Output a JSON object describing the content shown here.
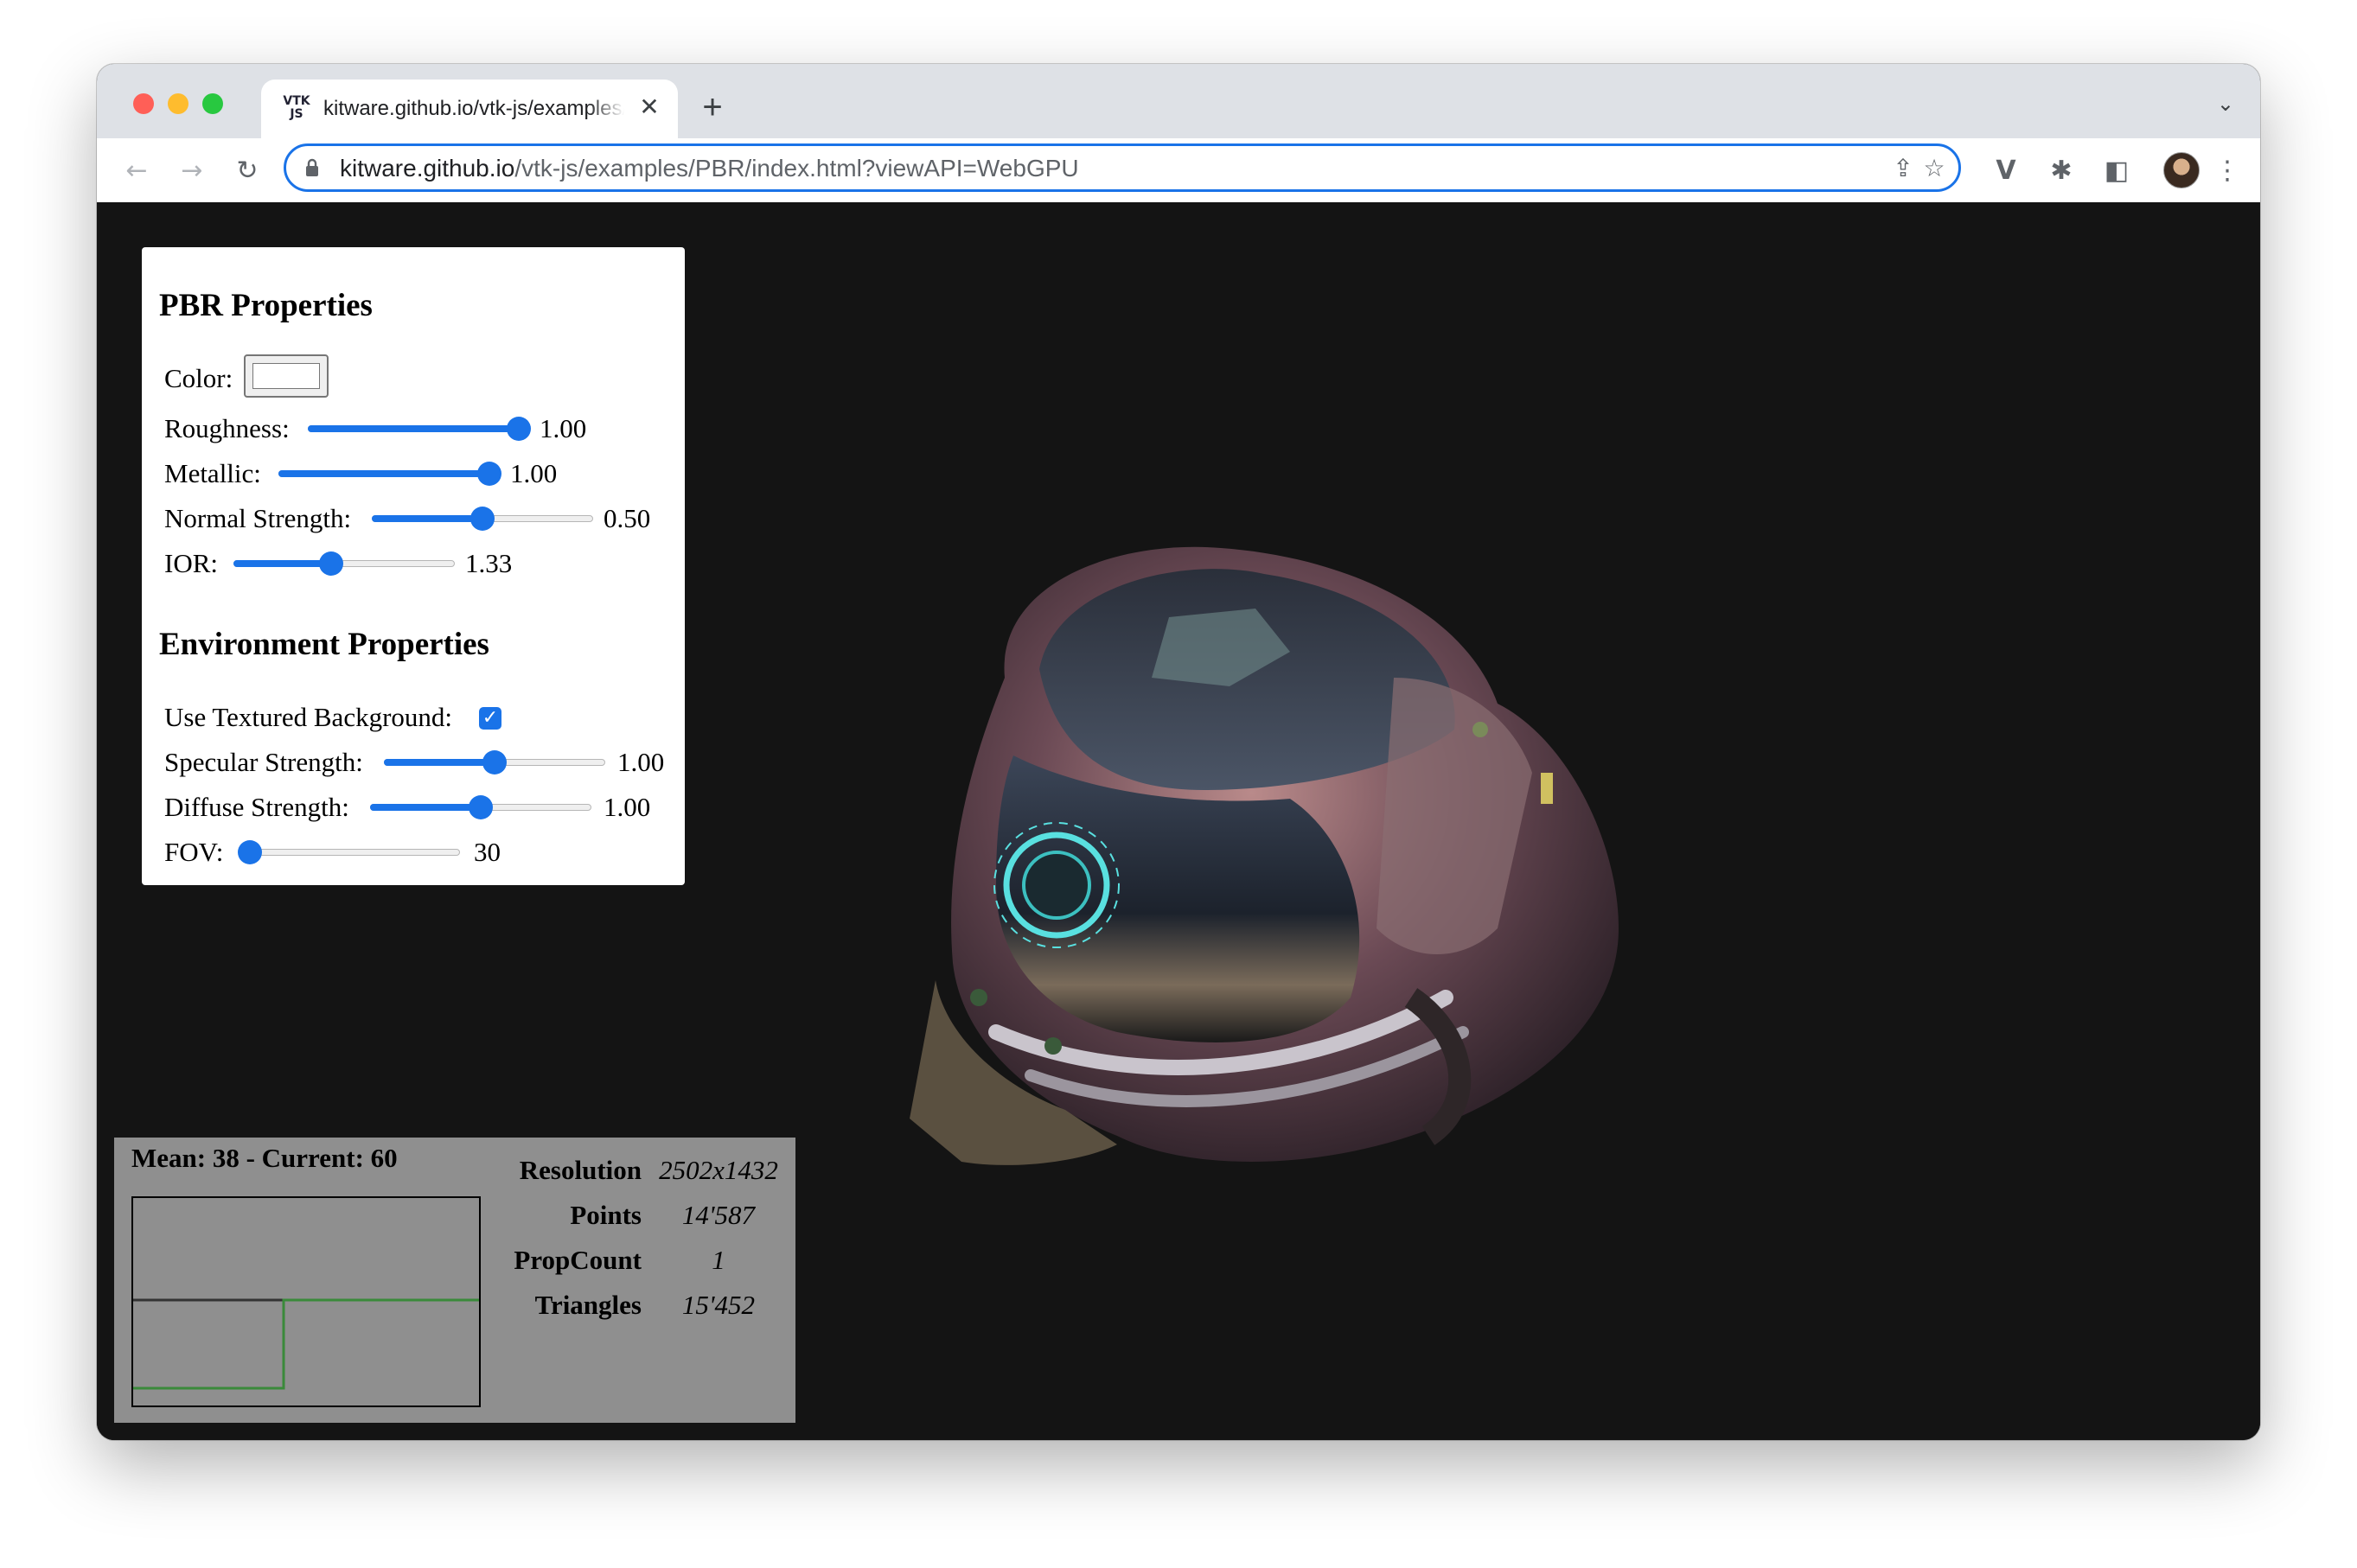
{
  "tab": {
    "title": "kitware.github.io/vtk-js/examples/PBR/index.html?viewAPI=WebGPU",
    "favicon_text": "VTK JS",
    "close_glyph": "✕"
  },
  "toolbar": {
    "url_host": "kitware.github.io",
    "url_path": "/vtk-js/examples/PBR/index.html?viewAPI=WebGPU"
  },
  "icons": {
    "back": "←",
    "forward": "→",
    "reload": "↻",
    "share": "⇪",
    "star": "☆",
    "new_tab": "+",
    "tab_menu": "⌄",
    "vtk": "V",
    "extensions": "✱",
    "sidepanel": "◧",
    "menu": "⋮",
    "check": "✓"
  },
  "colors": {
    "accent": "#1a73e8",
    "viewport_bg": "#141414",
    "stats_bg": "#8f8f8f",
    "graph_line": "#3a8a3a"
  },
  "pbr": {
    "heading": "PBR Properties",
    "color_label": "Color:",
    "color_value": "#ffffff",
    "roughness": {
      "label": "Roughness:",
      "value": "1.00",
      "fraction": 1.0
    },
    "metallic": {
      "label": "Metallic:",
      "value": "1.00",
      "fraction": 1.0
    },
    "normal_strength": {
      "label": "Normal Strength:",
      "value": "0.50",
      "fraction": 0.5
    },
    "ior": {
      "label": "IOR:",
      "value": "1.33",
      "fraction": 0.44
    }
  },
  "env": {
    "heading": "Environment Properties",
    "textured_bg": {
      "label": "Use Textured Background:",
      "checked": true
    },
    "specular_strength": {
      "label": "Specular Strength:",
      "value": "1.00",
      "fraction": 0.5
    },
    "diffuse_strength": {
      "label": "Diffuse Strength:",
      "value": "1.00",
      "fraction": 0.5
    },
    "fov": {
      "label": "FOV:",
      "value": "30",
      "fraction": 0.05
    }
  },
  "stats": {
    "fps_text": "Mean: 38 - Current: 60",
    "resolution_label": "Resolution",
    "resolution_value": "2502x1432",
    "points_label": "Points",
    "points_value": "14'587",
    "propcount_label": "PropCount",
    "propcount_value": "1",
    "triangles_label": "Triangles",
    "triangles_value": "15'452"
  }
}
